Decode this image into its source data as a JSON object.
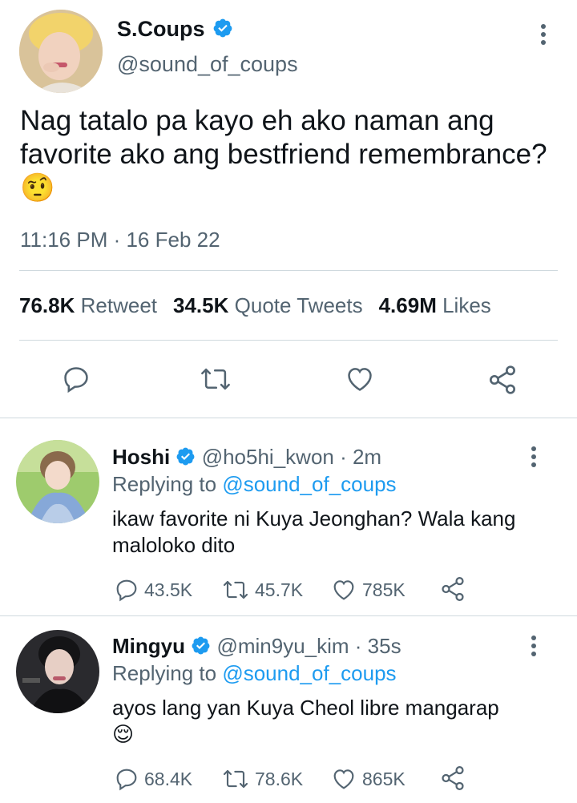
{
  "main_tweet": {
    "name": "S.Coups",
    "handle": "@sound_of_coups",
    "text": "Nag tatalo pa kayo eh ako naman ang favorite ako ang bestfriend remembrance?",
    "emoji": "🤨",
    "time": "11:16 PM · 16 Feb 22",
    "stats": [
      {
        "value": "76.8K",
        "label": "Retweet"
      },
      {
        "value": "34.5K",
        "label": "Quote Tweets"
      },
      {
        "value": "4.69M",
        "label": "Likes"
      }
    ],
    "icons": [
      "reply-icon",
      "retweet-icon",
      "like-icon",
      "share-icon"
    ]
  },
  "replies": [
    {
      "name": "Hoshi",
      "handle_meta": "@ho5hi_kwon · 2m",
      "replying_prefix": "Replying to ",
      "replying_to": "@sound_of_coups",
      "text": "ikaw favorite ni Kuya Jeonghan? Wala kang maloloko dito",
      "emoji": "",
      "replies": "43.5K",
      "retweets": "45.7K",
      "likes": "785K"
    },
    {
      "name": "Mingyu",
      "handle_meta": "@min9yu_kim · 35s",
      "replying_prefix": "Replying to ",
      "replying_to": "@sound_of_coups",
      "text": "ayos lang yan Kuya Cheol libre mangarap",
      "emoji": "😌",
      "replies": "68.4K",
      "retweets": "78.6K",
      "likes": "865K"
    }
  ],
  "colors": {
    "verified": "#1d9bf0",
    "link": "#1d9bf0",
    "muted": "#536471"
  }
}
